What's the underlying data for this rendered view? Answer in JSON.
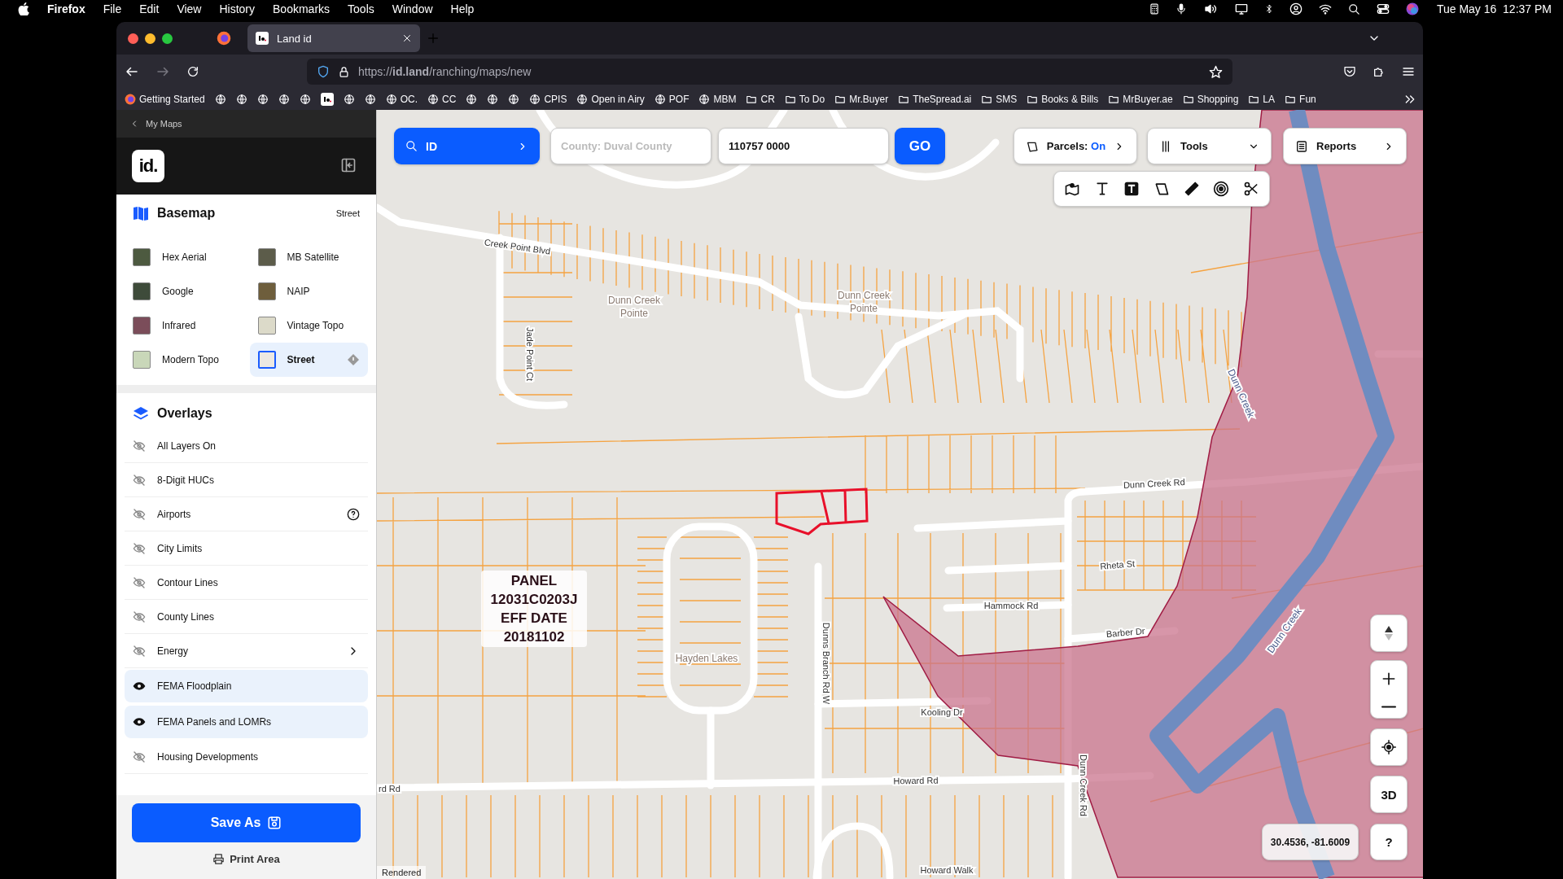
{
  "menu_bar": {
    "app": "Firefox",
    "menus": [
      "File",
      "Edit",
      "View",
      "History",
      "Bookmarks",
      "Tools",
      "Window",
      "Help"
    ],
    "clock": "Tue May 16  12:37 PM"
  },
  "browser": {
    "tabs": [
      {
        "title": "Land id",
        "selected": true
      }
    ],
    "url": "https://**id.land**/ranching/maps/new",
    "bookmarks": [
      {
        "kind": "firefox",
        "label": "Getting Started"
      },
      {
        "kind": "globe"
      },
      {
        "kind": "globe"
      },
      {
        "kind": "globe"
      },
      {
        "kind": "globe"
      },
      {
        "kind": "globe"
      },
      {
        "kind": "id"
      },
      {
        "kind": "globe"
      },
      {
        "kind": "globe"
      },
      {
        "kind": "globe",
        "label": "OC."
      },
      {
        "kind": "globe",
        "label": "CC"
      },
      {
        "kind": "globe"
      },
      {
        "kind": "globe"
      },
      {
        "kind": "globe"
      },
      {
        "kind": "globe",
        "label": "CPIS"
      },
      {
        "kind": "globe",
        "label": "Open in Airy"
      },
      {
        "kind": "globe",
        "label": "POF"
      },
      {
        "kind": "globe",
        "label": "MBM"
      },
      {
        "kind": "folder",
        "label": "CR"
      },
      {
        "kind": "folder",
        "label": "To Do"
      },
      {
        "kind": "folder",
        "label": "Mr.Buyer"
      },
      {
        "kind": "folder",
        "label": "TheSpread.ai"
      },
      {
        "kind": "folder",
        "label": "SMS"
      },
      {
        "kind": "folder",
        "label": "Books & Bills"
      },
      {
        "kind": "folder",
        "label": "MrBuyer.ae"
      },
      {
        "kind": "folder",
        "label": "Shopping"
      },
      {
        "kind": "folder",
        "label": "LA"
      },
      {
        "kind": "folder",
        "label": "Fun"
      }
    ]
  },
  "sidebar": {
    "back_link": "My Maps",
    "logo": "id.",
    "basemap": {
      "title": "Basemap",
      "current": "Street",
      "options": [
        {
          "label": "Hex Aerial",
          "selected": false
        },
        {
          "label": "MB Satellite",
          "selected": false
        },
        {
          "label": "Google",
          "selected": false
        },
        {
          "label": "NAIP",
          "selected": false
        },
        {
          "label": "Infrared",
          "selected": false
        },
        {
          "label": "Vintage Topo",
          "selected": false
        },
        {
          "label": "Modern Topo",
          "selected": false
        },
        {
          "label": "Street",
          "selected": true
        }
      ]
    },
    "overlays": {
      "title": "Overlays",
      "items": [
        {
          "label": "All Layers On",
          "visible": false,
          "kind": "plain"
        },
        {
          "label": "8-Digit HUCs",
          "visible": false,
          "kind": "plain"
        },
        {
          "label": "Airports",
          "visible": false,
          "kind": "help"
        },
        {
          "label": "City Limits",
          "visible": false,
          "kind": "plain"
        },
        {
          "label": "Contour Lines",
          "visible": false,
          "kind": "plain"
        },
        {
          "label": "County Lines",
          "visible": false,
          "kind": "plain"
        },
        {
          "label": "Energy",
          "visible": false,
          "kind": "submenu"
        },
        {
          "label": "FEMA Floodplain",
          "visible": true,
          "kind": "plain"
        },
        {
          "label": "FEMA Panels and LOMRs",
          "visible": true,
          "kind": "plain"
        },
        {
          "label": "Housing Developments",
          "visible": false,
          "kind": "plain"
        }
      ]
    },
    "save_button": "Save As",
    "print_link": "Print Area"
  },
  "map": {
    "search": {
      "mode": "ID",
      "county_placeholder": "County: Duval County",
      "parcel_value": "110757 0000",
      "go": "GO"
    },
    "parcels": {
      "label": "Parcels:",
      "value": "On"
    },
    "tools": "Tools",
    "reports": "Reports",
    "labels": [
      {
        "text": "Creek Point Blvd",
        "kind": "road"
      },
      {
        "text": "Dunn Creek",
        "kind": "place"
      },
      {
        "text": "Pointe",
        "kind": "place"
      },
      {
        "text": "Dunn Creek",
        "kind": "place"
      },
      {
        "text": "Pointe",
        "kind": "place"
      },
      {
        "text": "Jade Point Ct",
        "kind": "road"
      },
      {
        "text": "Dunn Creek Rd",
        "kind": "road"
      },
      {
        "text": "Rheta St",
        "kind": "road"
      },
      {
        "text": "Hammock Rd",
        "kind": "road"
      },
      {
        "text": "Barber Dr",
        "kind": "road"
      },
      {
        "text": "Kooling Dr",
        "kind": "road"
      },
      {
        "text": "Howard Rd",
        "kind": "road"
      },
      {
        "text": "rd Rd",
        "kind": "road"
      },
      {
        "text": "Dunns Branch Rd W",
        "kind": "road"
      },
      {
        "text": "Dunn Creek Rd",
        "kind": "road"
      },
      {
        "text": "Hayden Lakes",
        "kind": "place"
      },
      {
        "text": "Dunn Creek",
        "kind": "water"
      },
      {
        "text": "Dunn Creek",
        "kind": "water"
      },
      {
        "text": "Howard Walk",
        "kind": "road"
      }
    ],
    "panel_label": [
      "PANEL",
      "12031C0203J",
      "EFF DATE",
      "20181102"
    ],
    "coordinates": "30.4536, -81.6009",
    "view_3d": "3D",
    "help": "?",
    "status": "Rendered"
  }
}
